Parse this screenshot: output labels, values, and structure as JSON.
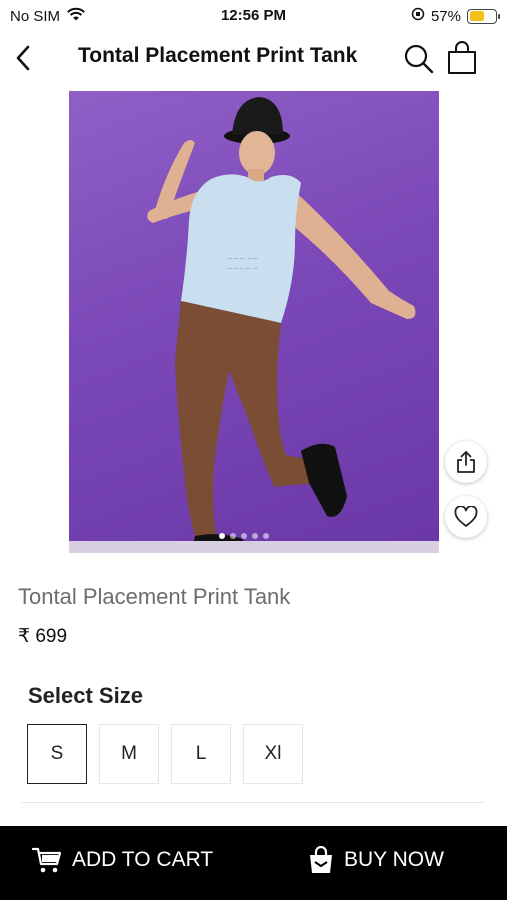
{
  "status_bar": {
    "carrier": "No SIM",
    "time": "12:56 PM",
    "battery": "57%",
    "battery_level": 0.57,
    "icons": [
      "wifi-icon",
      "orientation-lock-icon",
      "battery-icon"
    ]
  },
  "header": {
    "title": "Tontal Placement Print Tank",
    "icons": [
      "back-icon",
      "search-icon",
      "bag-icon"
    ]
  },
  "gallery": {
    "image_count": 5,
    "active_index": 0,
    "actions": [
      "share-icon",
      "heart-icon"
    ]
  },
  "product": {
    "name": "Tontal Placement Print Tank",
    "price": "₹ 699"
  },
  "size_selector": {
    "title": "Select Size",
    "options": [
      "S",
      "M",
      "L",
      "Xl"
    ],
    "selected": "S"
  },
  "actions": {
    "add_to_cart": "ADD TO CART",
    "buy_now": "BUY NOW"
  },
  "colors": {
    "accent": "#000000",
    "backdrop": "#7b48b7",
    "battery": "#f2c21b"
  }
}
